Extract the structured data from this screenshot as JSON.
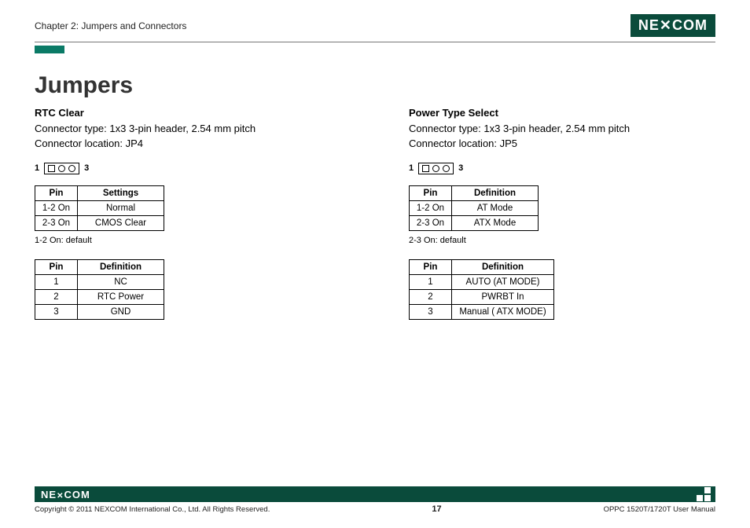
{
  "header": {
    "chapter": "Chapter 2: Jumpers and Connectors",
    "logo": "NEXCOM"
  },
  "title": "Jumpers",
  "left": {
    "heading": "RTC Clear",
    "conn_type": "Connector type: 1x3 3-pin header, 2.54 mm pitch",
    "conn_loc": "Connector location: JP4",
    "pin_left": "1",
    "pin_right": "3",
    "settings_table": {
      "head": [
        "Pin",
        "Settings"
      ],
      "rows": [
        [
          "1-2 On",
          "Normal"
        ],
        [
          "2-3 On",
          "CMOS Clear"
        ]
      ]
    },
    "note": "1-2 On: default",
    "def_table": {
      "head": [
        "Pin",
        "Definition"
      ],
      "rows": [
        [
          "1",
          "NC"
        ],
        [
          "2",
          "RTC Power"
        ],
        [
          "3",
          "GND"
        ]
      ]
    }
  },
  "right": {
    "heading": "Power Type Select",
    "conn_type": "Connector type: 1x3 3-pin header, 2.54 mm pitch",
    "conn_loc": "Connector location: JP5",
    "pin_left": "1",
    "pin_right": "3",
    "settings_table": {
      "head": [
        "Pin",
        "Definition"
      ],
      "rows": [
        [
          "1-2 On",
          "AT Mode"
        ],
        [
          "2-3 On",
          "ATX Mode"
        ]
      ]
    },
    "note": "2-3 On: default",
    "def_table": {
      "head": [
        "Pin",
        "Definition"
      ],
      "rows": [
        [
          "1",
          "AUTO (AT MODE)"
        ],
        [
          "2",
          "PWRBT In"
        ],
        [
          "3",
          "Manual ( ATX MODE)"
        ]
      ]
    }
  },
  "footer": {
    "logo": "NE COM",
    "copyright": "Copyright © 2011 NEXCOM International Co., Ltd. All Rights Reserved.",
    "page": "17",
    "doc": "OPPC 1520T/1720T User Manual"
  }
}
